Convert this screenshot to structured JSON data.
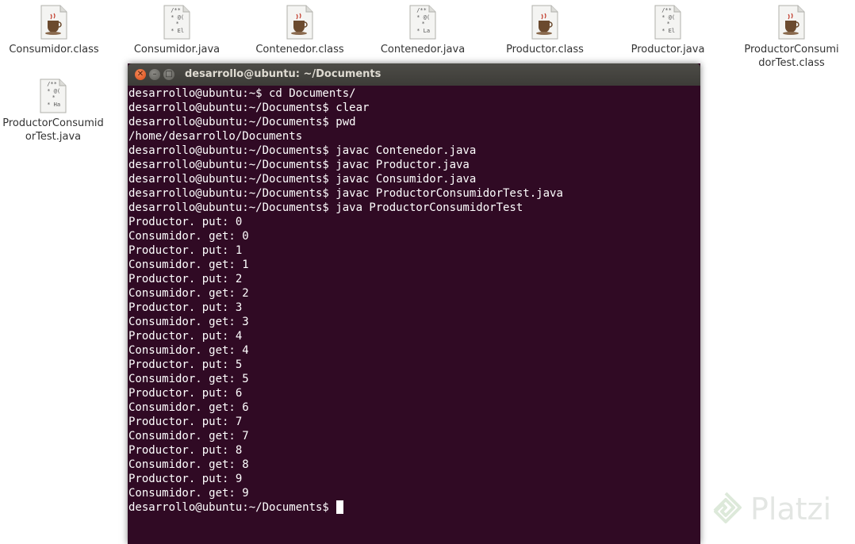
{
  "desktop": {
    "icons": [
      {
        "label": "Consumidor.class",
        "type": "class"
      },
      {
        "label": "Consumidor.java",
        "type": "java",
        "snippet": "/**\n * @(\n *\n * El"
      },
      {
        "label": "Contenedor.class",
        "type": "class"
      },
      {
        "label": "Contenedor.java",
        "type": "java",
        "snippet": "/**\n * @(\n *\n * La"
      },
      {
        "label": "Productor.class",
        "type": "class"
      },
      {
        "label": "Productor.java",
        "type": "java",
        "snippet": "/**\n * @(\n *\n * El"
      },
      {
        "label": "ProductorConsumidorTest.class",
        "type": "class"
      },
      {
        "label": "ProductorConsumidorTest.java",
        "type": "java",
        "snippet": "/**\n * @(\n *\n * Ha"
      }
    ]
  },
  "terminal": {
    "title": "desarrollo@ubuntu: ~/Documents",
    "background": "#300a24",
    "lines": [
      "desarrollo@ubuntu:~$ cd Documents/",
      "desarrollo@ubuntu:~/Documents$ clear",
      "desarrollo@ubuntu:~/Documents$ pwd",
      "/home/desarrollo/Documents",
      "desarrollo@ubuntu:~/Documents$ javac Contenedor.java",
      "desarrollo@ubuntu:~/Documents$ javac Productor.java",
      "desarrollo@ubuntu:~/Documents$ javac Consumidor.java",
      "desarrollo@ubuntu:~/Documents$ javac ProductorConsumidorTest.java",
      "desarrollo@ubuntu:~/Documents$ java ProductorConsumidorTest",
      "Productor. put: 0",
      "Consumidor. get: 0",
      "Productor. put: 1",
      "Consumidor. get: 1",
      "Productor. put: 2",
      "Consumidor. get: 2",
      "Productor. put: 3",
      "Consumidor. get: 3",
      "Productor. put: 4",
      "Consumidor. get: 4",
      "Productor. put: 5",
      "Consumidor. get: 5",
      "Productor. put: 6",
      "Consumidor. get: 6",
      "Productor. put: 7",
      "Consumidor. get: 7",
      "Productor. put: 8",
      "Consumidor. get: 8",
      "Productor. put: 9",
      "Consumidor. get: 9"
    ],
    "prompt": "desarrollo@ubuntu:~/Documents$"
  },
  "watermark": {
    "text": "Platzi"
  }
}
